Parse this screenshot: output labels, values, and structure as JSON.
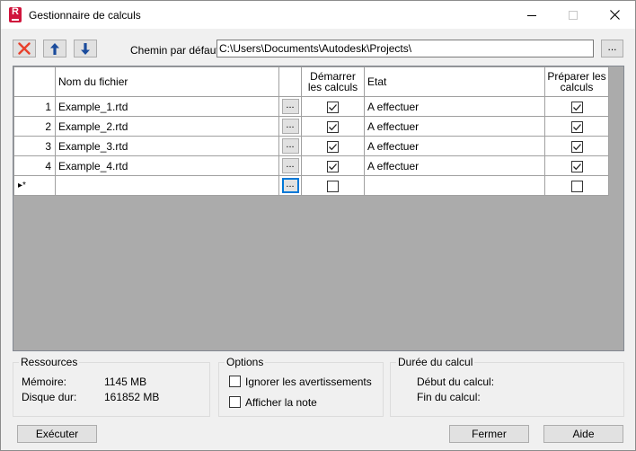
{
  "window": {
    "title": "Gestionnaire de calculs",
    "app_icon_letter": "R"
  },
  "toolbar": {
    "delete_icon": "red-x-icon",
    "up_icon": "arrow-up-icon",
    "down_icon": "arrow-down-icon",
    "path_label": "Chemin par défaut",
    "path_value": "C:\\Users\\Documents\\Autodesk\\Projects\\",
    "browse_label": "..."
  },
  "grid": {
    "headers": {
      "filename": "Nom du fichier",
      "start_line1": "Démarrer",
      "start_line2": "les calculs",
      "status": "Etat",
      "prepare_line1": "Préparer les",
      "prepare_line2": "calculs"
    },
    "cell_button_label": "...",
    "new_row_marker": "▸*",
    "rows": [
      {
        "num": "1",
        "file": "Example_1.rtd",
        "start": true,
        "status": "A effectuer",
        "prepare": true
      },
      {
        "num": "2",
        "file": "Example_2.rtd",
        "start": true,
        "status": "A effectuer",
        "prepare": true
      },
      {
        "num": "3",
        "file": "Example_3.rtd",
        "start": true,
        "status": "A effectuer",
        "prepare": true
      },
      {
        "num": "4",
        "file": "Example_4.rtd",
        "start": true,
        "status": "A effectuer",
        "prepare": true
      }
    ],
    "new_row": {
      "start": false,
      "prepare": false
    }
  },
  "resources": {
    "title": "Ressources",
    "memory_label": "Mémoire:",
    "memory_value": "1145 MB",
    "disk_label": "Disque dur:",
    "disk_value": "161852 MB"
  },
  "options": {
    "title": "Options",
    "ignore_warnings": "Ignorer les avertissements",
    "show_note": "Afficher la note",
    "ignore_warnings_checked": false,
    "show_note_checked": false
  },
  "duration": {
    "title": "Durée du calcul",
    "start_label": "Début du calcul:",
    "end_label": "Fin du calcul:"
  },
  "buttons": {
    "execute": "Exécuter",
    "close": "Fermer",
    "help": "Aide"
  },
  "colors": {
    "delete_red": "#e8412c",
    "arrow_blue": "#1a4b9c",
    "focus_blue": "#0078d7",
    "grid_background": "#ababab"
  }
}
